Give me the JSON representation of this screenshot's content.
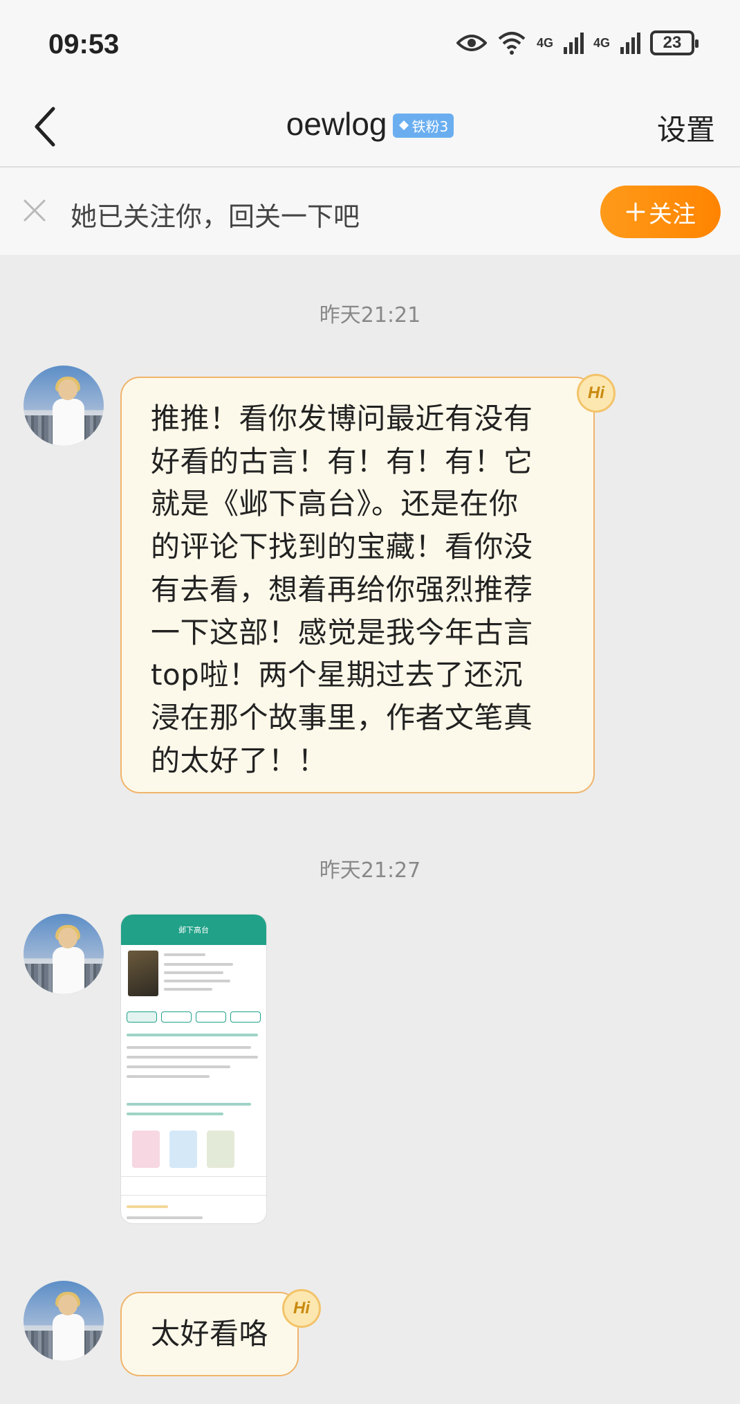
{
  "status_bar": {
    "time": "09:53",
    "network_1": "4G",
    "network_2": "4G",
    "battery": "23",
    "icons": [
      "eye-icon",
      "wifi-icon",
      "signal-icon",
      "signal-icon",
      "battery-icon"
    ]
  },
  "nav": {
    "title": "oewlog",
    "badge": "铁粉3",
    "settings_label": "设置",
    "back_icon": "chevron-left-icon"
  },
  "follow_banner": {
    "text": "她已关注你，回关一下吧",
    "button_label": "关注",
    "button_icon": "plus-icon",
    "close_icon": "close-icon",
    "accent_color": "#ff8c0a"
  },
  "messages": [
    {
      "time": "昨天21:21",
      "lines": [
        "推推！看你发博问最近有没有",
        "好看的古言！有！有！有！它",
        "就是《邺下高台》。还是在你",
        "的评论下找到的宝藏！看你没",
        "有去看，想着再给你强烈推荐",
        "一下这部！感觉是我今年古言",
        "top啦！两个星期过去了还沉",
        "浸在那个故事里，作者文笔真",
        "的太好了！！"
      ],
      "badge": "Hi"
    },
    {
      "time": "昨天21:27",
      "image_title": "邺下高台"
    },
    {
      "text": "太好看咯",
      "badge": "Hi"
    }
  ],
  "colors": {
    "bubble_bg": "#fdf9ea",
    "bubble_border": "#f0b46a",
    "chat_bg": "#ececec",
    "thumb_green": "#20a188"
  }
}
